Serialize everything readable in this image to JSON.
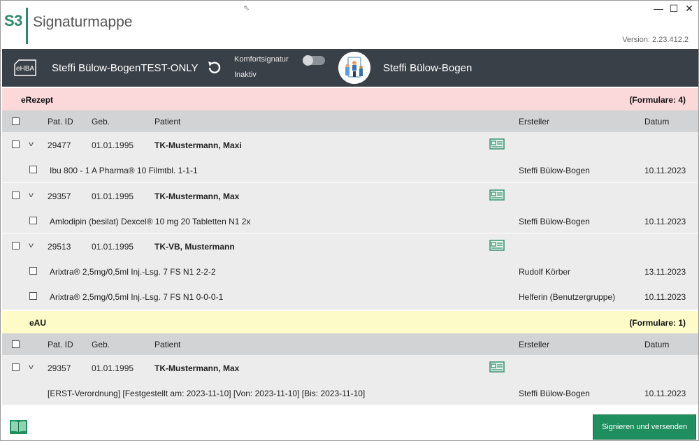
{
  "app": {
    "logo": "S3",
    "title": "Signaturmappe",
    "version": "Version: 2.23.412.2"
  },
  "window_controls": {
    "minimize": "—",
    "maximize": "☐",
    "close": "✕"
  },
  "header": {
    "card_label": "eHBA",
    "card_user": "Steffi Bülow-BogenTEST-ONLY",
    "komfort_label": "Komfortsignatur",
    "komfort_status": "Inaktiv",
    "komfort_enabled": false,
    "user_name": "Steffi  Bülow-Bogen"
  },
  "columns": {
    "pat_id": "Pat. ID",
    "geb": "Geb.",
    "patient": "Patient",
    "ersteller": "Ersteller",
    "datum": "Datum"
  },
  "erezept": {
    "title": "eRezept",
    "count": "(Formulare: 4)",
    "color": "#fbd9db",
    "patients": [
      {
        "pat_id": "29477",
        "geb": "01.01.1995",
        "name": "TK-Mustermann, Maxi",
        "items": [
          {
            "text": "Ibu 800 - 1 A Pharma® 10 Filmtbl. 1-1-1",
            "ersteller": "Steffi Bülow-Bogen",
            "datum": "10.11.2023"
          }
        ]
      },
      {
        "pat_id": "29357",
        "geb": "01.01.1995",
        "name": "TK-Mustermann, Max",
        "items": [
          {
            "text": "Amlodipin (besilat) Dexcel® 10 mg 20 Tabletten N1 2x",
            "ersteller": "Steffi Bülow-Bogen",
            "datum": "10.11.2023"
          }
        ]
      },
      {
        "pat_id": "29513",
        "geb": "01.01.1995",
        "name": "TK-VB, Mustermann",
        "items": [
          {
            "text": "Arixtra® 2,5mg/0,5ml Inj.-Lsg. 7 FS N1 2-2-2",
            "ersteller": "Rudolf Körber",
            "datum": "13.11.2023"
          },
          {
            "text": "Arixtra® 2,5mg/0,5ml Inj.-Lsg. 7 FS N1 0-0-0-1",
            "ersteller": "Helferin (Benutzergruppe)",
            "datum": "10.11.2023"
          }
        ]
      }
    ]
  },
  "eau": {
    "title": "eAU",
    "count": "(Formulare: 1)",
    "color": "#fdfbc8",
    "patients": [
      {
        "pat_id": "29357",
        "geb": "01.01.1995",
        "name": "TK-Mustermann, Max",
        "items": [
          {
            "text": "[ERST-Verordnung] [Festgestellt am: 2023-11-10] [Von: 2023-11-10] [Bis: 2023-11-10]",
            "ersteller": "Steffi Bülow-Bogen",
            "datum": "10.11.2023"
          }
        ]
      }
    ]
  },
  "footer": {
    "sign_button": "Signieren und versenden"
  },
  "colors": {
    "accent": "#2c8a68",
    "dark_bar": "#3a4047",
    "sign_button": "#1f8f5f"
  }
}
